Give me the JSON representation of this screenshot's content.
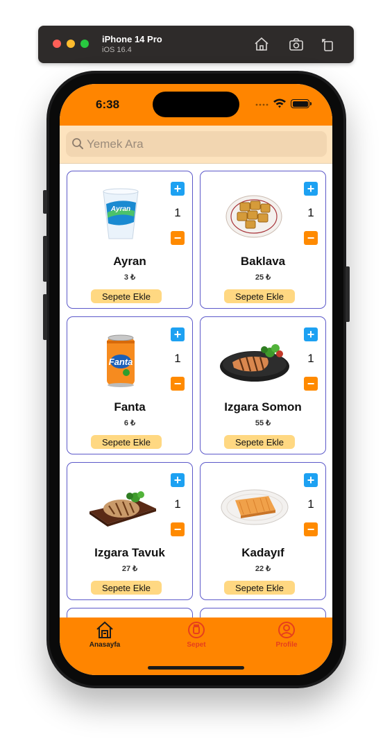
{
  "simulator": {
    "device_name": "iPhone 14 Pro",
    "os_version": "iOS 16.4",
    "icons": [
      "home-icon",
      "screenshot-icon",
      "rotate-icon"
    ]
  },
  "status_bar": {
    "time": "6:38"
  },
  "search": {
    "placeholder": "Yemek Ara"
  },
  "products": [
    {
      "name": "Ayran",
      "price": "3 ₺",
      "quantity": "1",
      "add_label": "Sepete Ekle",
      "image": "ayran-cup"
    },
    {
      "name": "Baklava",
      "price": "25 ₺",
      "quantity": "1",
      "add_label": "Sepete Ekle",
      "image": "baklava-plate"
    },
    {
      "name": "Fanta",
      "price": "6 ₺",
      "quantity": "1",
      "add_label": "Sepete Ekle",
      "image": "fanta-can"
    },
    {
      "name": "Izgara Somon",
      "price": "55 ₺",
      "quantity": "1",
      "add_label": "Sepete Ekle",
      "image": "grilled-salmon"
    },
    {
      "name": "Izgara Tavuk",
      "price": "27 ₺",
      "quantity": "1",
      "add_label": "Sepete Ekle",
      "image": "grilled-chicken"
    },
    {
      "name": "Kadayıf",
      "price": "22 ₺",
      "quantity": "1",
      "add_label": "Sepete Ekle",
      "image": "kadayif-plate"
    }
  ],
  "tab_bar": {
    "tabs": [
      {
        "label": "Anasayfa",
        "icon": "home-icon",
        "selected": true
      },
      {
        "label": "Sepet",
        "icon": "cart-icon",
        "selected": false
      },
      {
        "label": "Profile",
        "icon": "profile-icon",
        "selected": false
      }
    ]
  },
  "colors": {
    "brand_orange": "#ff8500",
    "search_bg": "#fde3be",
    "card_border": "#5b58c9",
    "plus_blue": "#1da1f2",
    "minus_orange": "#ff8a00",
    "add_button": "#ffd882",
    "tab_inactive": "#e63e1d"
  }
}
